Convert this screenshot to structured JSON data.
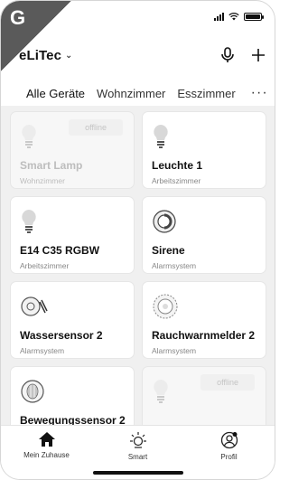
{
  "corner_badge": {
    "letter": "G"
  },
  "header": {
    "home_name": "eLiTec",
    "caret": "⌄"
  },
  "tabs": [
    {
      "label": "Alle Geräte",
      "active": true
    },
    {
      "label": "Wohnzimmer",
      "active": false
    },
    {
      "label": "Esszimmer",
      "active": false
    }
  ],
  "tabs_more": "···",
  "devices": [
    {
      "name": "Smart Lamp",
      "room": "Wohnzimmer",
      "status": "offline",
      "icon": "bulb-icon"
    },
    {
      "name": "Leuchte 1",
      "room": "Arbeitszimmer",
      "status": "",
      "icon": "bulb-icon"
    },
    {
      "name": "E14 C35 RGBW",
      "room": "Arbeitszimmer",
      "status": "",
      "icon": "bulb-icon"
    },
    {
      "name": "Sirene",
      "room": "Alarmsystem",
      "status": "",
      "icon": "siren-icon"
    },
    {
      "name": "Wassersensor 2",
      "room": "Alarmsystem",
      "status": "",
      "icon": "water-sensor-icon"
    },
    {
      "name": "Rauchwarnmelder 2",
      "room": "Alarmsystem",
      "status": "",
      "icon": "smoke-detector-icon"
    },
    {
      "name": "Bewegungssensor 2",
      "room": "",
      "status": "",
      "icon": "motion-sensor-icon"
    },
    {
      "name": "",
      "room": "",
      "status": "offline",
      "icon": "bulb-icon"
    }
  ],
  "bottom_nav": [
    {
      "label": "Mein Zuhause",
      "icon": "home-icon"
    },
    {
      "label": "Smart",
      "icon": "smart-sun-icon"
    },
    {
      "label": "Profil",
      "icon": "profile-icon"
    }
  ],
  "colors": {
    "accent": "#111111",
    "background": "#f0f0f0",
    "card": "#ffffff"
  }
}
